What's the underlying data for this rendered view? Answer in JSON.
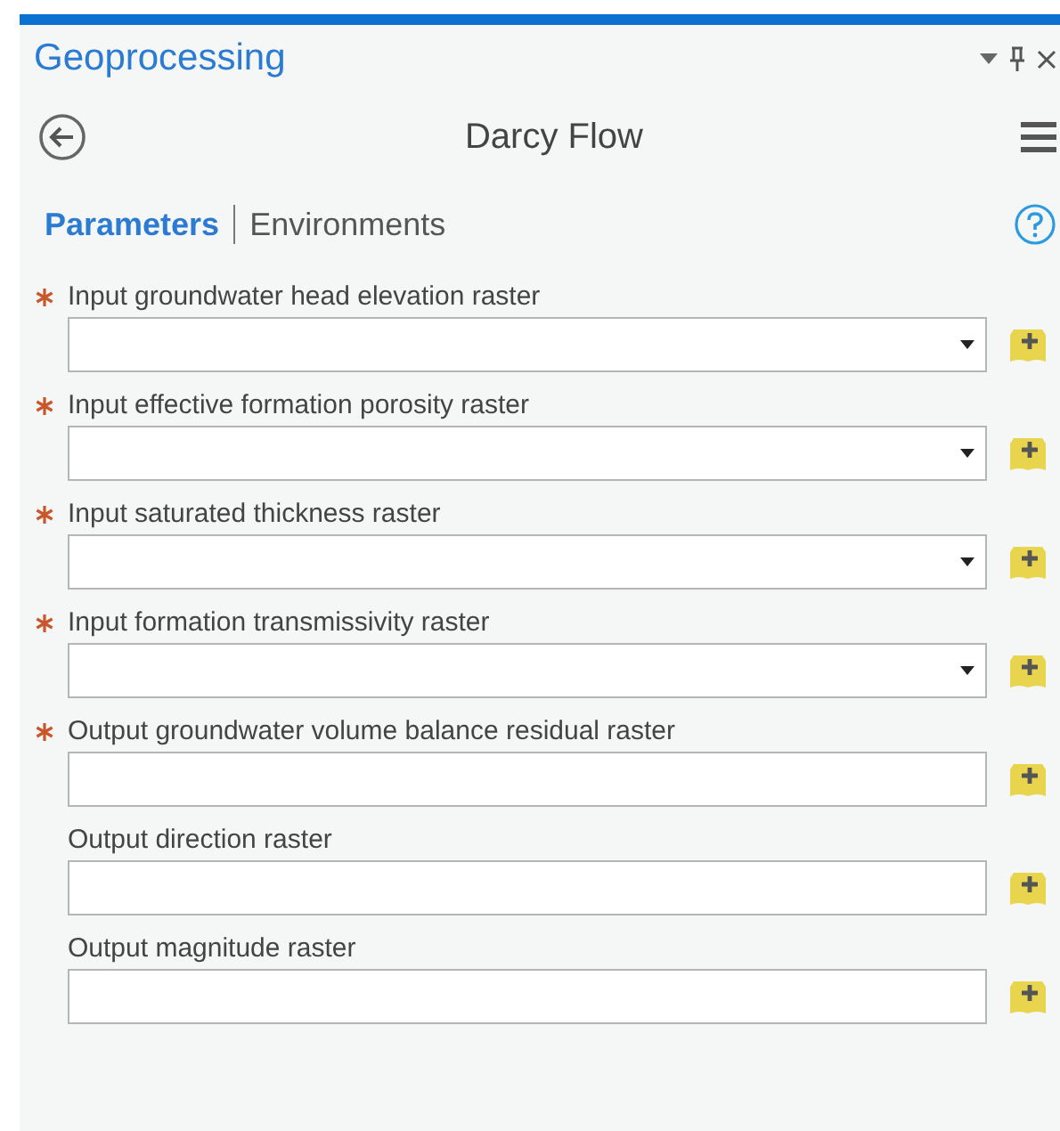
{
  "pane": {
    "title": "Geoprocessing"
  },
  "tool": {
    "title": "Darcy Flow"
  },
  "tabs": [
    {
      "label": "Parameters",
      "selected": true
    },
    {
      "label": "Environments",
      "selected": false
    }
  ],
  "parameters": [
    {
      "label": "Input groundwater head elevation raster",
      "required": true,
      "kind": "dropdown"
    },
    {
      "label": "Input effective formation porosity raster",
      "required": true,
      "kind": "dropdown"
    },
    {
      "label": "Input saturated thickness raster",
      "required": true,
      "kind": "dropdown"
    },
    {
      "label": "Input formation transmissivity raster",
      "required": true,
      "kind": "dropdown"
    },
    {
      "label": "Output groundwater volume balance residual raster",
      "required": true,
      "kind": "text"
    },
    {
      "label": "Output direction raster",
      "required": false,
      "kind": "text"
    },
    {
      "label": "Output magnitude raster",
      "required": false,
      "kind": "text"
    }
  ]
}
